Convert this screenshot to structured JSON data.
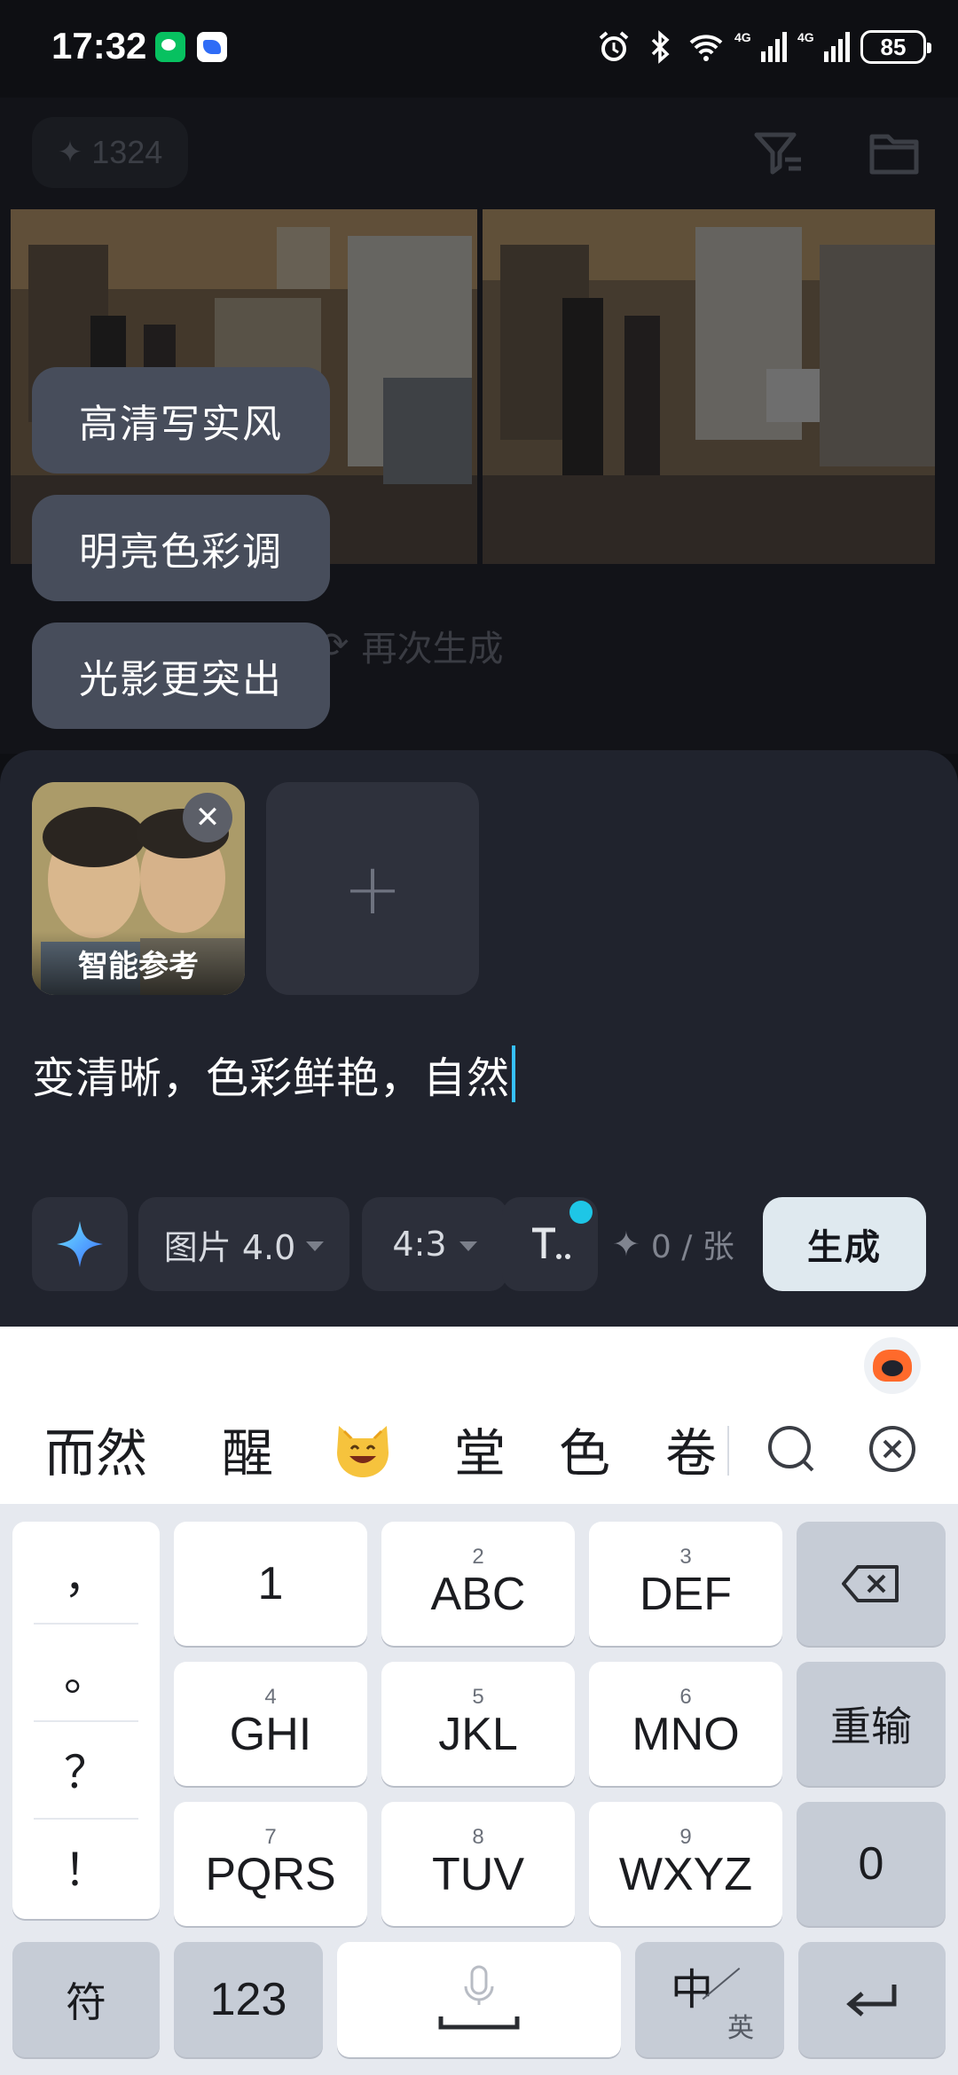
{
  "status_bar": {
    "time": "17:32",
    "notification_icons": [
      "wechat-icon",
      "feishu-icon"
    ],
    "system_icons": [
      "alarm-icon",
      "bluetooth-icon",
      "wifi-icon",
      "signal-4g-icon",
      "signal-4g-icon"
    ],
    "signal_label": "4G",
    "battery": "85"
  },
  "background_app": {
    "credits": "1324",
    "regenerate_label": "再次生成"
  },
  "suggestions": [
    "高清写实风",
    "明亮色彩调",
    "光影更突出"
  ],
  "input_panel": {
    "reference_label": "智能参考",
    "prompt_text": "变清晰，色彩鲜艳，自然",
    "model_label": "图片 4.0",
    "ratio_label": "4:3",
    "cost_label": "0 / 张",
    "generate_label": "生成"
  },
  "ime": {
    "candidates": [
      "而然",
      "醒",
      "堂",
      "色",
      "卷"
    ],
    "emoji_candidate": "grinning-cat-emoji",
    "keys": {
      "punctuation": [
        "，",
        "。",
        "？",
        "！"
      ],
      "row1": [
        {
          "num": "",
          "label": "1"
        },
        {
          "num": "2",
          "label": "ABC"
        },
        {
          "num": "3",
          "label": "DEF"
        }
      ],
      "row2": [
        {
          "num": "4",
          "label": "GHI"
        },
        {
          "num": "5",
          "label": "JKL"
        },
        {
          "num": "6",
          "label": "MNO"
        }
      ],
      "row3": [
        {
          "num": "7",
          "label": "PQRS"
        },
        {
          "num": "8",
          "label": "TUV"
        },
        {
          "num": "9",
          "label": "WXYZ"
        }
      ],
      "reinput": "重输",
      "zero": "0",
      "symbols": "符",
      "numbers": "123",
      "zh": "中",
      "en": "英"
    }
  },
  "colors": {
    "accent": "#36c0ff",
    "badge": "#1ec6e6",
    "generate_button": "#dfe9ef",
    "chip": "#474d5b",
    "panel": "#20232d"
  }
}
